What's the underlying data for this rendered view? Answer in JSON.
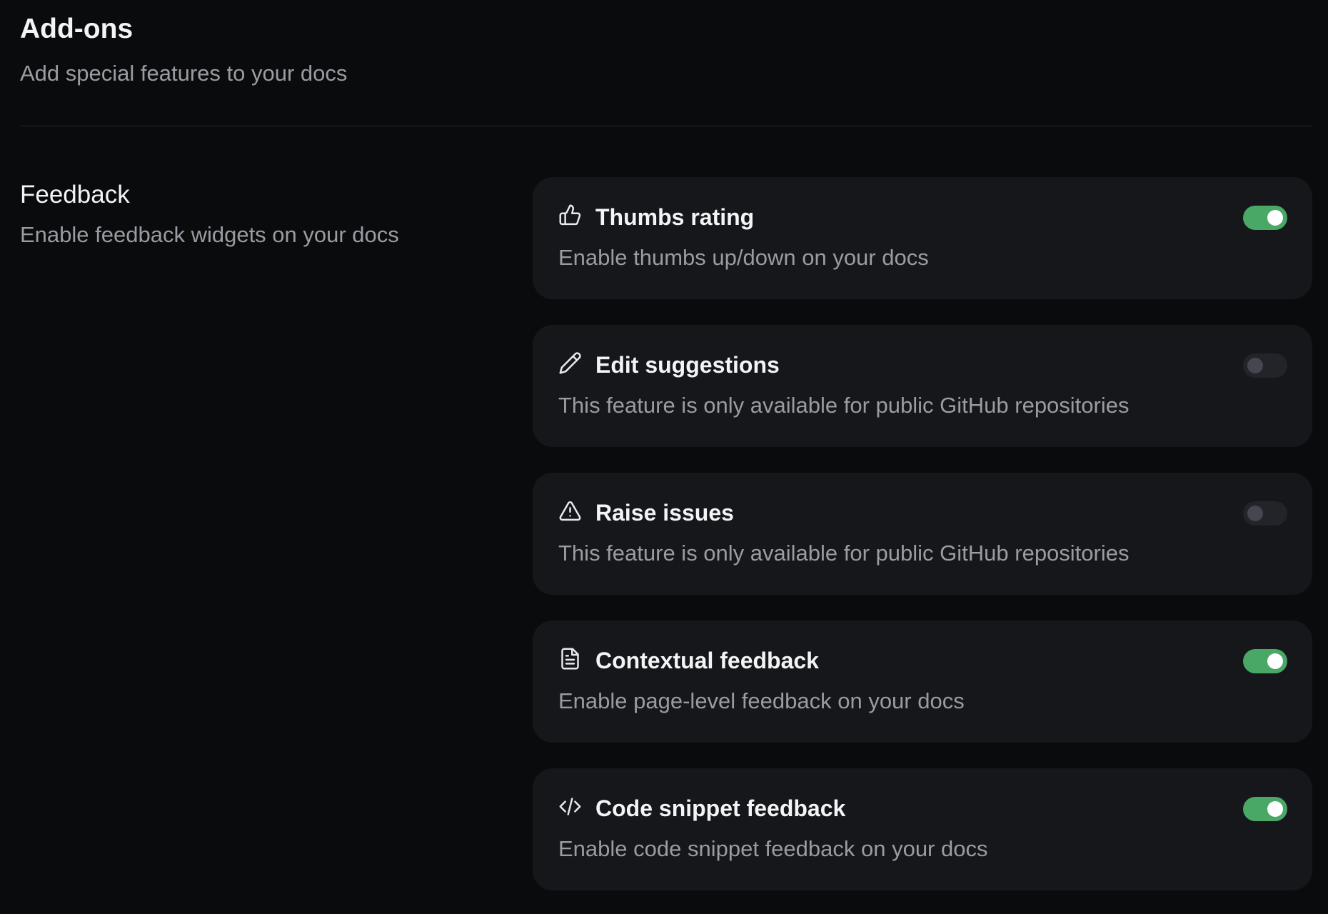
{
  "header": {
    "title": "Add-ons",
    "subtitle": "Add special features to your docs"
  },
  "section": {
    "title": "Feedback",
    "description": "Enable feedback widgets on your docs"
  },
  "colors": {
    "toggle_on": "#4aa866",
    "toggle_off": "#22242a",
    "card_bg": "#15171b",
    "page_bg": "#0a0b0d"
  },
  "addons": [
    {
      "icon": "thumbs-up-icon",
      "title": "Thumbs rating",
      "description": "Enable thumbs up/down on your docs",
      "enabled": true
    },
    {
      "icon": "pencil-icon",
      "title": "Edit suggestions",
      "description": "This feature is only available for public GitHub repositories",
      "enabled": false
    },
    {
      "icon": "warning-triangle-icon",
      "title": "Raise issues",
      "description": "This feature is only available for public GitHub repositories",
      "enabled": false
    },
    {
      "icon": "document-icon",
      "title": "Contextual feedback",
      "description": "Enable page-level feedback on your docs",
      "enabled": true
    },
    {
      "icon": "code-icon",
      "title": "Code snippet feedback",
      "description": "Enable code snippet feedback on your docs",
      "enabled": true
    }
  ]
}
